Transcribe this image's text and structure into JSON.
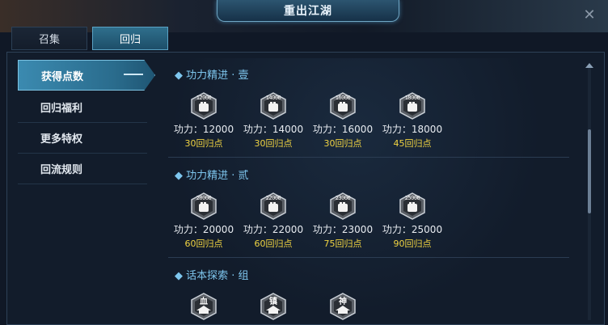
{
  "window": {
    "title": "重出江湖"
  },
  "tabs": [
    {
      "label": "召集",
      "active": false
    },
    {
      "label": "回归",
      "active": true
    }
  ],
  "sidebar": {
    "items": [
      {
        "label": "获得点数",
        "active": true
      },
      {
        "label": "回归福利",
        "active": false
      },
      {
        "label": "更多特权",
        "active": false
      },
      {
        "label": "回流规则",
        "active": false
      }
    ]
  },
  "sections": [
    {
      "title": "◆ 功力精进 · 壹",
      "rewards": [
        {
          "badge": "12000",
          "power": "功力：12000",
          "points": "30回归点"
        },
        {
          "badge": "14000",
          "power": "功力：14000",
          "points": "30回归点"
        },
        {
          "badge": "16000",
          "power": "功力：16000",
          "points": "30回归点"
        },
        {
          "badge": "18000",
          "power": "功力：18000",
          "points": "45回归点"
        }
      ]
    },
    {
      "title": "◆ 功力精进 · 贰",
      "rewards": [
        {
          "badge": "20000",
          "power": "功力：20000",
          "points": "60回归点"
        },
        {
          "badge": "22000",
          "power": "功力：22000",
          "points": "60回归点"
        },
        {
          "badge": "23000",
          "power": "功力：23000",
          "points": "75回归点"
        },
        {
          "badge": "25000",
          "power": "功力：25000",
          "points": "90回归点"
        }
      ]
    },
    {
      "title": "◆ 话本探索 · 组",
      "rewards": [
        {
          "badge": "血"
        },
        {
          "badge": "镇"
        },
        {
          "badge": "神"
        }
      ]
    }
  ],
  "colors": {
    "accent": "#7ec6ee",
    "points": "#f1d442",
    "active_tab": "#2f6f8c"
  },
  "icons": {
    "close": "close-icon",
    "badge": "fist-shield-icon",
    "scene": "pavilion-shield-icon"
  }
}
